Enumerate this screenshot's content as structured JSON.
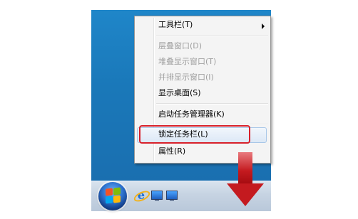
{
  "context_menu": {
    "items": [
      {
        "label": "工具栏(T)",
        "enabled": true,
        "has_submenu": true
      },
      {
        "label": "层叠窗口(D)",
        "enabled": false
      },
      {
        "label": "堆叠显示窗口(T)",
        "enabled": false
      },
      {
        "label": "并排显示窗口(I)",
        "enabled": false
      },
      {
        "label": "显示桌面(S)",
        "enabled": true
      },
      {
        "label": "启动任务管理器(K)",
        "enabled": true
      },
      {
        "label": "锁定任务栏(L)",
        "enabled": true,
        "highlighted": true
      },
      {
        "label": "属性(R)",
        "enabled": true
      }
    ]
  },
  "taskbar": {
    "icons": [
      "start-orb-icon",
      "internet-explorer-icon",
      "show-desktop-icon",
      "switch-windows-icon"
    ]
  },
  "annotation": {
    "highlight_color": "#d8202a",
    "arrow_color": "#c41a1f"
  }
}
